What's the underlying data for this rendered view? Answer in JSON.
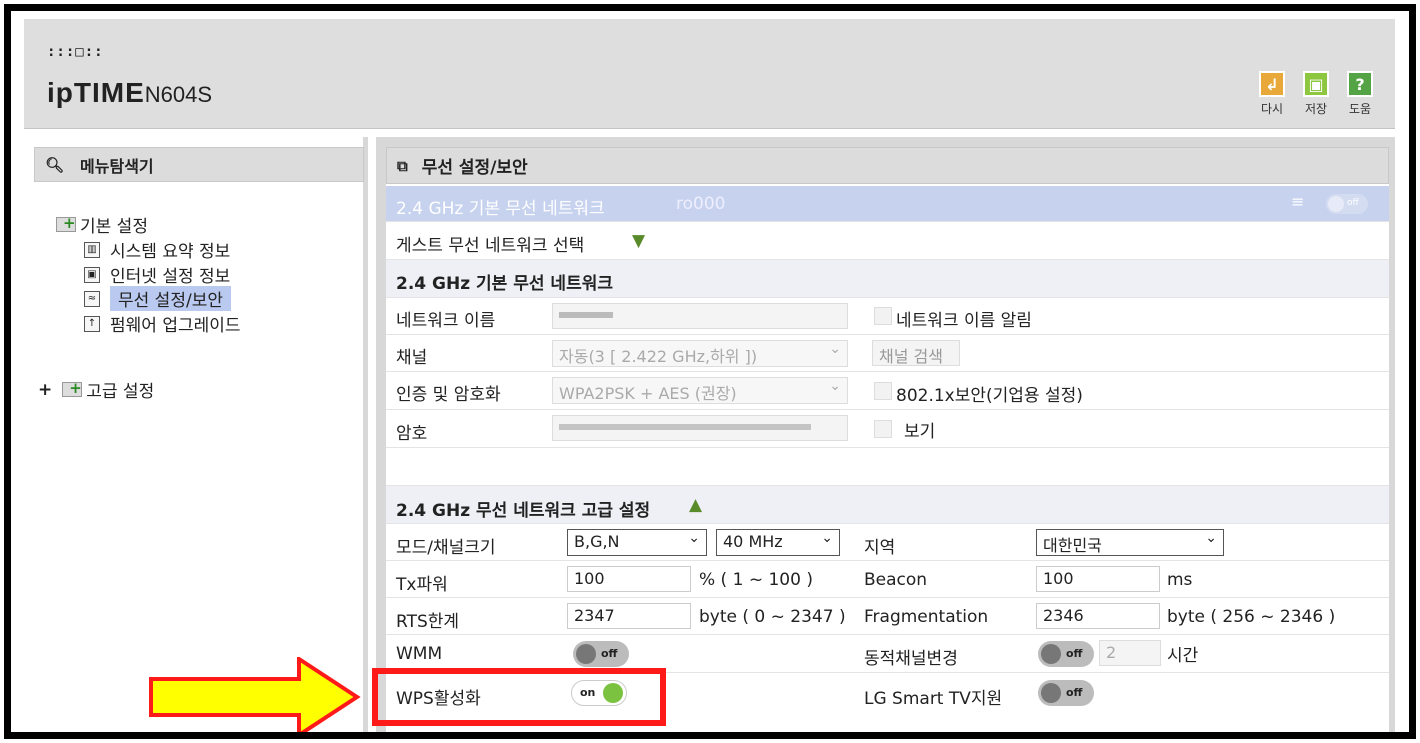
{
  "header": {
    "brand_mark": ":::□::",
    "brand_text": "ipTIME",
    "model": "N604S",
    "toolbar": {
      "reset_label": "다시",
      "save_label": "저장",
      "help_label": "도움",
      "help_glyph": "?",
      "colors": {
        "reset": "#e8a93a",
        "save": "#8dc63f",
        "help": "#54a345"
      }
    }
  },
  "sidebar": {
    "title": "메뉴탐색기",
    "basic": {
      "label": "기본 설정",
      "items": [
        {
          "label": "시스템 요약 정보",
          "icon": "chart-icon"
        },
        {
          "label": "인터넷 설정 정보",
          "icon": "network-icon"
        },
        {
          "label": "무선 설정/보안",
          "icon": "wireless-icon",
          "selected": true
        },
        {
          "label": "펌웨어 업그레이드",
          "icon": "upgrade-icon"
        }
      ]
    },
    "advanced": {
      "expander": "+",
      "label": "고급 설정"
    }
  },
  "main": {
    "title": "무선 설정/보안",
    "network_bar": {
      "label": "2.4 GHz 기본 무선 네트워크",
      "ssid": "ro000",
      "toggle": "off"
    },
    "guest_select_label": "게스트 무선 네트워크 선택",
    "basic": {
      "title": "2.4 GHz 기본 무선 네트워크",
      "network_name_label": "네트워크 이름",
      "broadcast_label": "네트워크 이름 알림",
      "channel_label": "채널",
      "channel_value": "자동(3 [ 2.422 GHz,하위 ])",
      "channel_search_label": "채널 검색",
      "auth_label": "인증 및 암호화",
      "auth_value": "WPA2PSK + AES (권장)",
      "enterprise_label": "802.1x보안(기업용 설정)",
      "password_label": "암호",
      "show_label": "보기"
    },
    "advanced": {
      "title": "2.4 GHz 무선 네트워크 고급 설정",
      "mode_label": "모드/채널크기",
      "mode_value": "B,G,N",
      "bandwidth_value": "40 MHz",
      "region_label": "지역",
      "region_value": "대한민국",
      "tx_label": "Tx파워",
      "tx_value": "100",
      "tx_unit": "% ( 1 ~ 100 )",
      "beacon_label": "Beacon",
      "beacon_value": "100",
      "beacon_unit": "ms",
      "rts_label": "RTS한계",
      "rts_value": "2347",
      "rts_unit": "byte ( 0 ~ 2347 )",
      "frag_label": "Fragmentation",
      "frag_value": "2346",
      "frag_unit": "byte ( 256 ~ 2346 )",
      "wmm_label": "WMM",
      "wmm_state": "off",
      "dyn_label": "동적채널변경",
      "dyn_state": "off",
      "dyn_value": "2",
      "dyn_unit": "시간",
      "wps_label": "WPS활성화",
      "wps_state": "on",
      "lgtv_label": "LG Smart TV지원",
      "lgtv_state": "off"
    }
  },
  "annotations": {
    "highlight_color": "#ff1a1a",
    "arrow_color": "#ffff00"
  }
}
